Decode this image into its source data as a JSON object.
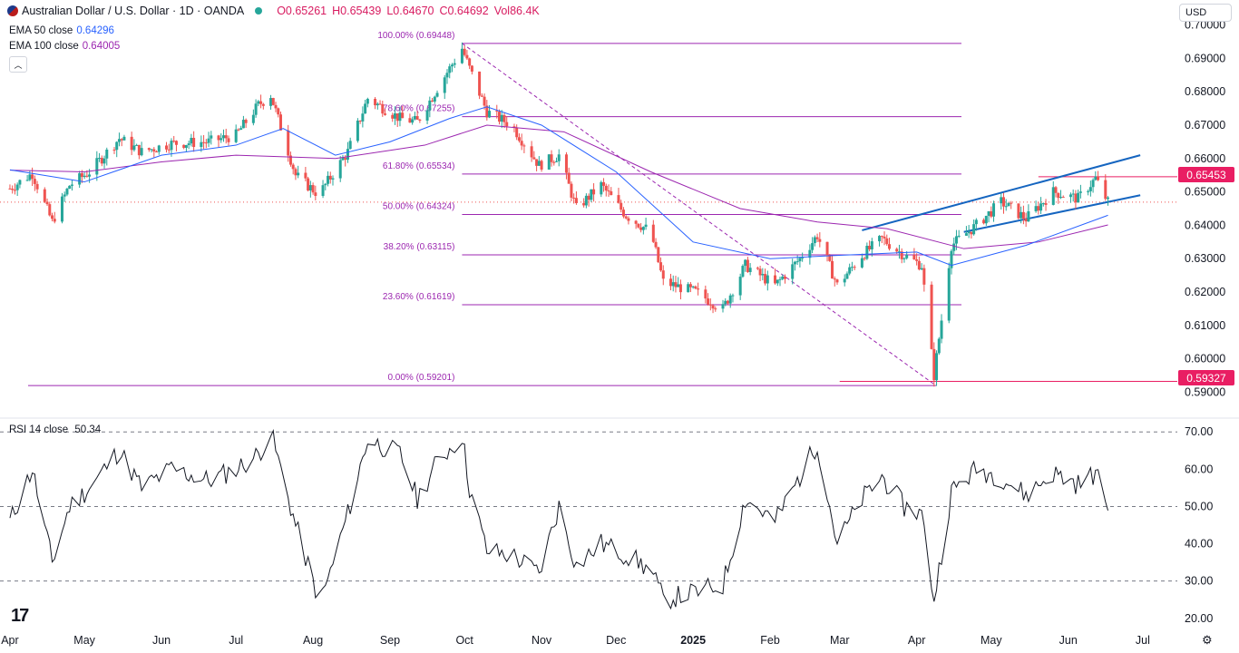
{
  "header": {
    "symbol": "Australian Dollar / U.S. Dollar · 1D · OANDA",
    "open": "O0.65261",
    "high": "H0.65439",
    "low": "L0.64670",
    "close": "C0.64692",
    "volume": "Vol86.4K",
    "currency": "USD"
  },
  "indicators": {
    "ema50_label": "EMA 50 close",
    "ema50_value": "0.64296",
    "ema100_label": "EMA 100 close",
    "ema100_value": "0.64005",
    "rsi_label": "RSI 14 close",
    "rsi_value": "50.34"
  },
  "price_tags": {
    "upper": "0.65453",
    "lower": "0.59327"
  },
  "colors": {
    "up": "#26a69a",
    "down": "#ef5350",
    "ema50": "#2962ff",
    "ema100": "#9c27b0",
    "fib": "#9c27b0",
    "channel": "#1565c0",
    "tag": "#e91e63"
  },
  "chart_data": [
    {
      "type": "candlestick",
      "title": "Australian Dollar / U.S. Dollar · 1D · OANDA",
      "y_ticks": [
        "0.70000",
        "0.69000",
        "0.68000",
        "0.67000",
        "0.66000",
        "0.65000",
        "0.64000",
        "0.63000",
        "0.62000",
        "0.61000",
        "0.60000",
        "0.59000"
      ],
      "ylim": [
        0.5885,
        0.7015
      ],
      "x_ticks": [
        "Apr",
        "May",
        "Jun",
        "Jul",
        "Aug",
        "Sep",
        "Oct",
        "Nov",
        "Dec",
        "2025",
        "Feb",
        "Mar",
        "Apr",
        "May",
        "Jun",
        "Jul"
      ],
      "close_path": [
        [
          "2024-04-01",
          0.651
        ],
        [
          "2024-04-10",
          0.6555
        ],
        [
          "2024-04-18",
          0.641
        ],
        [
          "2024-04-25",
          0.652
        ],
        [
          "2024-05-03",
          0.656
        ],
        [
          "2024-05-15",
          0.666
        ],
        [
          "2024-05-24",
          0.662
        ],
        [
          "2024-06-05",
          0.6645
        ],
        [
          "2024-06-20",
          0.665
        ],
        [
          "2024-07-01",
          0.667
        ],
        [
          "2024-07-10",
          0.676
        ],
        [
          "2024-07-15",
          0.679
        ],
        [
          "2024-07-25",
          0.655
        ],
        [
          "2024-08-02",
          0.65
        ],
        [
          "2024-08-05",
          0.651
        ],
        [
          "2024-08-15",
          0.662
        ],
        [
          "2024-08-23",
          0.678
        ],
        [
          "2024-09-05",
          0.672
        ],
        [
          "2024-09-12",
          0.671
        ],
        [
          "2024-09-20",
          0.681
        ],
        [
          "2024-09-30",
          0.693
        ],
        [
          "2024-10-03",
          0.687
        ],
        [
          "2024-10-10",
          0.674
        ],
        [
          "2024-10-20",
          0.67
        ],
        [
          "2024-10-31",
          0.658
        ],
        [
          "2024-11-08",
          0.661
        ],
        [
          "2024-11-15",
          0.645
        ],
        [
          "2024-11-25",
          0.652
        ],
        [
          "2024-12-05",
          0.643
        ],
        [
          "2024-12-15",
          0.638
        ],
        [
          "2024-12-20",
          0.623
        ],
        [
          "2025-01-02",
          0.62
        ],
        [
          "2025-01-13",
          0.615
        ],
        [
          "2025-01-22",
          0.628
        ],
        [
          "2025-02-03",
          0.622
        ],
        [
          "2025-02-13",
          0.63
        ],
        [
          "2025-02-20",
          0.637
        ],
        [
          "2025-02-28",
          0.622
        ],
        [
          "2025-03-10",
          0.631
        ],
        [
          "2025-03-18",
          0.636
        ],
        [
          "2025-03-27",
          0.631
        ],
        [
          "2025-04-03",
          0.628
        ],
        [
          "2025-04-08",
          0.595
        ],
        [
          "2025-04-15",
          0.634
        ],
        [
          "2025-04-25",
          0.64
        ],
        [
          "2025-05-05",
          0.647
        ],
        [
          "2025-05-15",
          0.642
        ],
        [
          "2025-05-26",
          0.65
        ],
        [
          "2025-06-05",
          0.648
        ],
        [
          "2025-06-12",
          0.654
        ],
        [
          "2025-06-17",
          0.6469
        ]
      ],
      "ema50": [
        [
          "2024-04-01",
          0.6566
        ],
        [
          "2024-05-01",
          0.653
        ],
        [
          "2024-06-01",
          0.661
        ],
        [
          "2024-07-01",
          0.664
        ],
        [
          "2024-07-20",
          0.669
        ],
        [
          "2024-08-10",
          0.661
        ],
        [
          "2024-09-01",
          0.665
        ],
        [
          "2024-09-25",
          0.672
        ],
        [
          "2024-10-10",
          0.6755
        ],
        [
          "2024-11-01",
          0.67
        ],
        [
          "2024-12-01",
          0.656
        ],
        [
          "2025-01-01",
          0.635
        ],
        [
          "2025-02-01",
          0.63
        ],
        [
          "2025-03-01",
          0.631
        ],
        [
          "2025-04-01",
          0.632
        ],
        [
          "2025-04-15",
          0.628
        ],
        [
          "2025-05-15",
          0.634
        ],
        [
          "2025-06-17",
          0.643
        ]
      ],
      "ema100": [
        [
          "2024-04-01",
          0.6565
        ],
        [
          "2024-05-01",
          0.656
        ],
        [
          "2024-06-01",
          0.659
        ],
        [
          "2024-07-01",
          0.661
        ],
        [
          "2024-08-10",
          0.66
        ],
        [
          "2024-09-15",
          0.664
        ],
        [
          "2024-10-10",
          0.67
        ],
        [
          "2024-11-10",
          0.668
        ],
        [
          "2024-12-15",
          0.656
        ],
        [
          "2025-01-20",
          0.645
        ],
        [
          "2025-02-20",
          0.641
        ],
        [
          "2025-03-20",
          0.639
        ],
        [
          "2025-04-20",
          0.633
        ],
        [
          "2025-05-20",
          0.635
        ],
        [
          "2025-06-17",
          0.6401
        ]
      ],
      "fibonacci": [
        {
          "level": "100.00%",
          "price": "0.69448",
          "value": 0.69448
        },
        {
          "level": "78.60%",
          "price": "0.67255",
          "value": 0.67255
        },
        {
          "level": "61.80%",
          "price": "0.65534",
          "value": 0.65534
        },
        {
          "level": "50.00%",
          "price": "0.64324",
          "value": 0.64324
        },
        {
          "level": "38.20%",
          "price": "0.63115",
          "value": 0.63115
        },
        {
          "level": "23.60%",
          "price": "0.61619",
          "value": 0.61619
        },
        {
          "level": "0.00%",
          "price": "0.59201",
          "value": 0.59201
        }
      ],
      "channel": {
        "upper": [
          [
            "2025-03-10",
            0.6385
          ],
          [
            "2025-06-30",
            0.661
          ]
        ],
        "lower": [
          [
            "2025-04-20",
            0.638
          ],
          [
            "2025-06-30",
            0.649
          ]
        ]
      },
      "horizontal_levels": [
        0.65453,
        0.59327
      ]
    },
    {
      "type": "line",
      "title": "RSI 14 close",
      "y_ticks": [
        "70.00",
        "60.00",
        "50.00",
        "40.00",
        "30.00",
        "20.00"
      ],
      "ylim": [
        18,
        72
      ],
      "guides": [
        70,
        50,
        30
      ],
      "values": [
        [
          "2024-04-01",
          46
        ],
        [
          "2024-04-10",
          60
        ],
        [
          "2024-04-18",
          35
        ],
        [
          "2024-04-25",
          50
        ],
        [
          "2024-05-03",
          55
        ],
        [
          "2024-05-15",
          65
        ],
        [
          "2024-05-24",
          55
        ],
        [
          "2024-06-05",
          60
        ],
        [
          "2024-06-20",
          57
        ],
        [
          "2024-07-01",
          60
        ],
        [
          "2024-07-10",
          64
        ],
        [
          "2024-07-15",
          70
        ],
        [
          "2024-07-25",
          45
        ],
        [
          "2024-08-02",
          28
        ],
        [
          "2024-08-05",
          26
        ],
        [
          "2024-08-15",
          48
        ],
        [
          "2024-08-23",
          68
        ],
        [
          "2024-09-05",
          64
        ],
        [
          "2024-09-12",
          52
        ],
        [
          "2024-09-20",
          62
        ],
        [
          "2024-09-30",
          69
        ],
        [
          "2024-10-03",
          55
        ],
        [
          "2024-10-10",
          38
        ],
        [
          "2024-10-20",
          37
        ],
        [
          "2024-10-31",
          32
        ],
        [
          "2024-11-08",
          50
        ],
        [
          "2024-11-15",
          34
        ],
        [
          "2024-11-25",
          40
        ],
        [
          "2024-12-05",
          37
        ],
        [
          "2024-12-15",
          33
        ],
        [
          "2024-12-20",
          25
        ],
        [
          "2025-01-02",
          27
        ],
        [
          "2025-01-13",
          29
        ],
        [
          "2025-01-22",
          52
        ],
        [
          "2025-02-03",
          46
        ],
        [
          "2025-02-13",
          58
        ],
        [
          "2025-02-20",
          67
        ],
        [
          "2025-02-28",
          40
        ],
        [
          "2025-03-10",
          52
        ],
        [
          "2025-03-18",
          58
        ],
        [
          "2025-03-27",
          50
        ],
        [
          "2025-04-03",
          48
        ],
        [
          "2025-04-08",
          25
        ],
        [
          "2025-04-15",
          54
        ],
        [
          "2025-04-25",
          60
        ],
        [
          "2025-05-05",
          58
        ],
        [
          "2025-05-15",
          53
        ],
        [
          "2025-05-26",
          59
        ],
        [
          "2025-06-05",
          56
        ],
        [
          "2025-06-12",
          59
        ],
        [
          "2025-06-17",
          50.34
        ]
      ]
    }
  ]
}
